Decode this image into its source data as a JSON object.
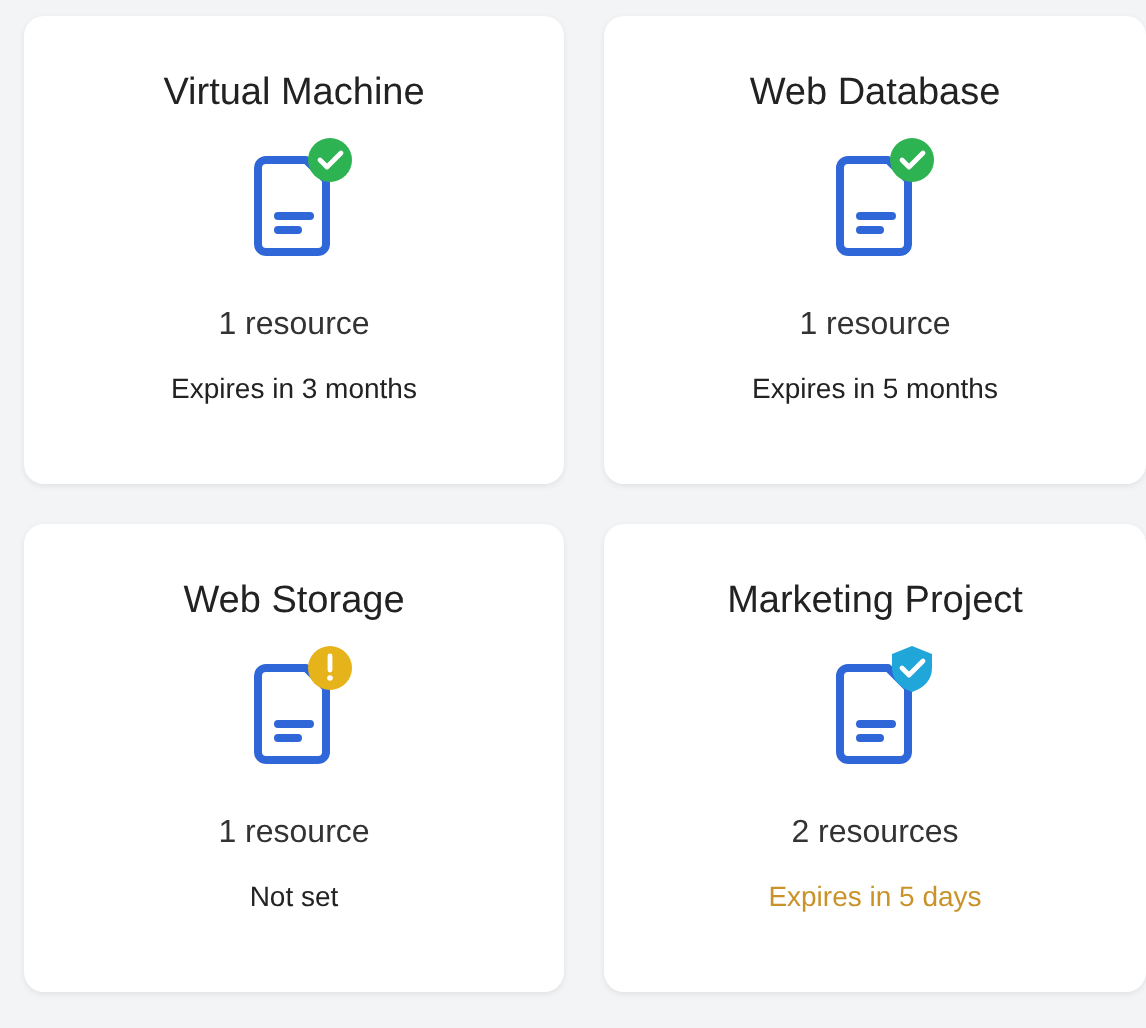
{
  "cards": [
    {
      "title": "Virtual Machine",
      "kind": "check",
      "resources": "1 resource",
      "expiry": "Expires in 3 months",
      "expiring_soon": false
    },
    {
      "title": "Web Database",
      "kind": "check",
      "resources": "1 resource",
      "expiry": "Expires in 5 months",
      "expiring_soon": false
    },
    {
      "title": "Web Storage",
      "kind": "warning",
      "resources": "1 resource",
      "expiry": "Not set",
      "expiring_soon": false
    },
    {
      "title": "Marketing Project",
      "kind": "shield",
      "resources": "2 resources",
      "expiry": "Expires in 5 days",
      "expiring_soon": true
    }
  ]
}
